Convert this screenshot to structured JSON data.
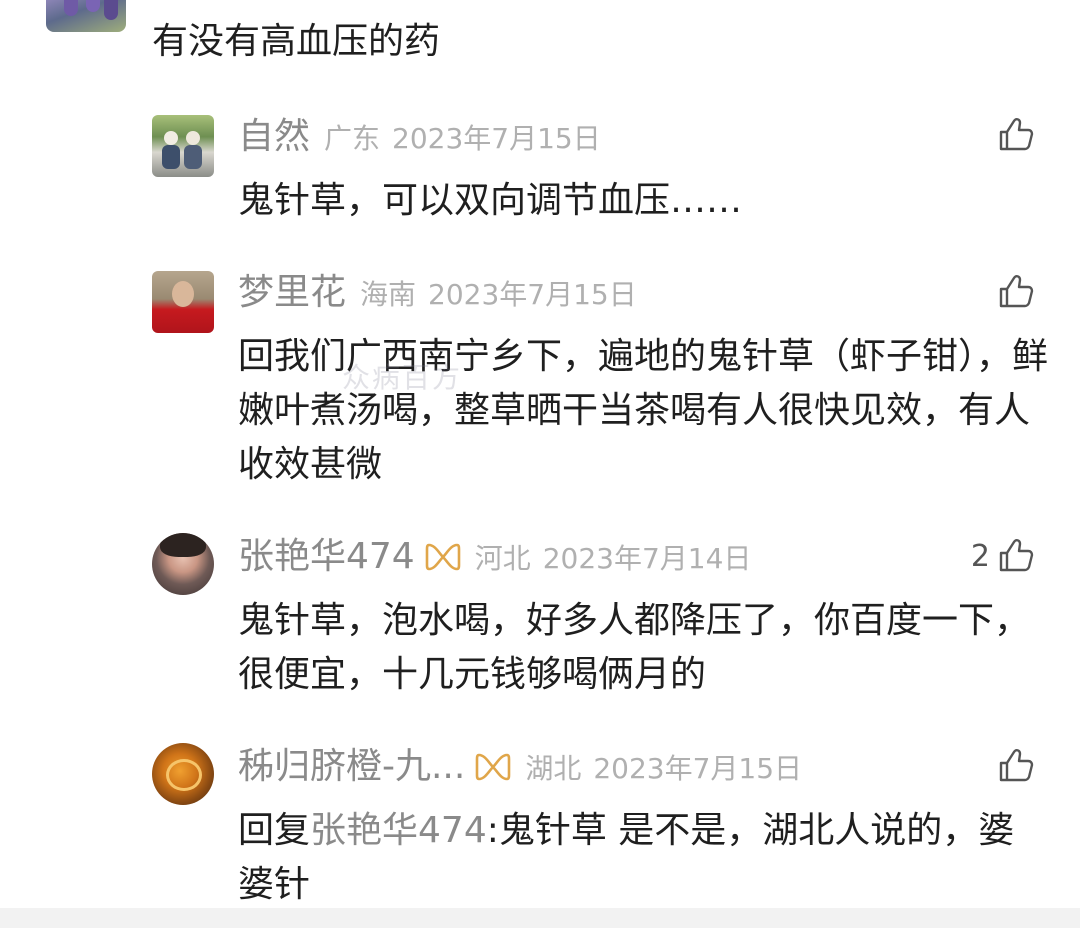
{
  "main_comment": {
    "text": "有没有高血压的药"
  },
  "watermark": "众病百方",
  "replies": [
    {
      "username": "自然",
      "location": "广东",
      "date": "2023年7月15日",
      "like_count": "",
      "text": "鬼针草，可以双向调节血压……",
      "has_vip_badge": false
    },
    {
      "username": "梦里花",
      "location": "海南",
      "date": "2023年7月15日",
      "like_count": "",
      "text": "回我们广西南宁乡下，遍地的鬼针草（虾子钳），鲜嫩叶煮汤喝，整草晒干当茶喝有人很快见效，有人收效甚微",
      "has_vip_badge": false
    },
    {
      "username": "张艳华474",
      "location": "河北",
      "date": "2023年7月14日",
      "like_count": "2",
      "text": "鬼针草，泡水喝，好多人都降压了，你百度一下，很便宜，十几元钱够喝俩月的",
      "has_vip_badge": true
    },
    {
      "username": "秭归脐橙-九...",
      "location": "湖北",
      "date": "2023年7月15日",
      "like_count": "",
      "reply_prefix": "回复",
      "mention": "张艳华474",
      "text": ":鬼针草 是不是，湖北人说的，婆婆针",
      "has_vip_badge": true
    }
  ],
  "colors": {
    "username": "#8a8a8a",
    "meta": "#b0b0b0",
    "text": "#1f1f1f",
    "vip_badge": "#e0a64a",
    "icon": "#555555"
  },
  "icons": {
    "like": "thumbs-up-icon",
    "vip": "vip-badge-icon"
  }
}
